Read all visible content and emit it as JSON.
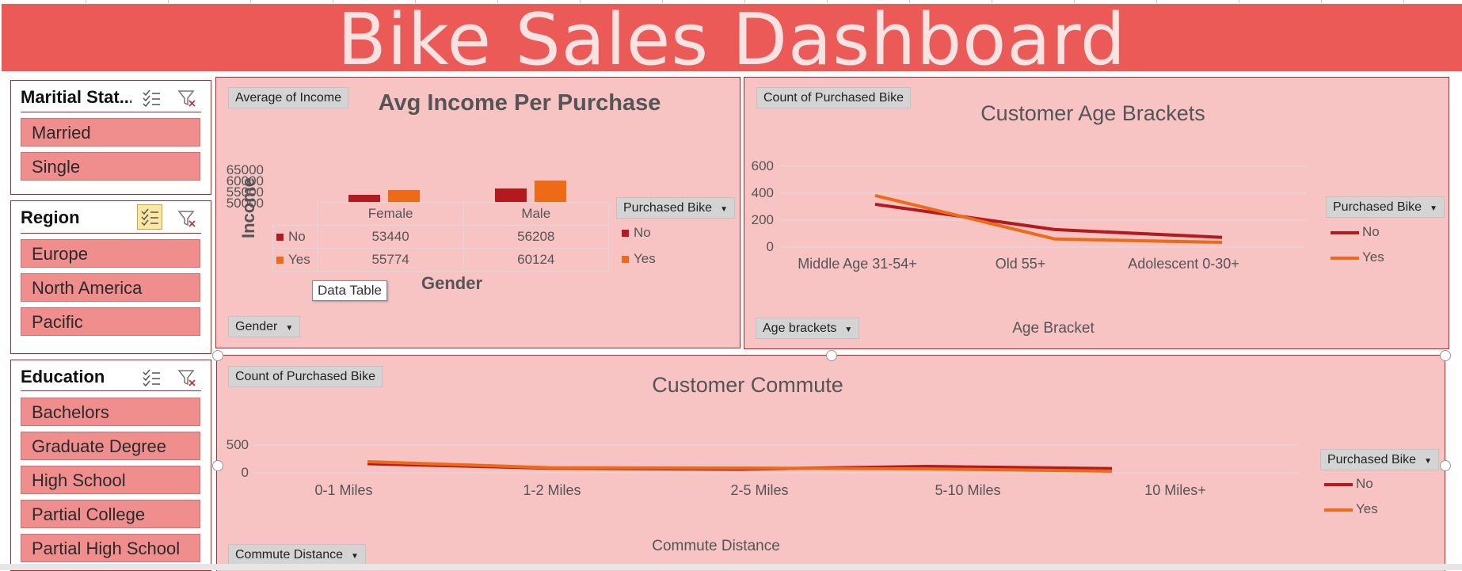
{
  "dashboard": {
    "title": "Bike Sales Dashboard"
  },
  "colors": {
    "banner": "#ec5a57",
    "panel_bg": "#f7c3c3",
    "slicer_btn": "#f08d8d",
    "series_no": "#b3191d",
    "series_yes": "#ee6a17"
  },
  "slicers": {
    "marital": {
      "title": "Maritial Stat...",
      "items": [
        "Married",
        "Single"
      ]
    },
    "region": {
      "title": "Region",
      "items": [
        "Europe",
        "North America",
        "Pacific"
      ]
    },
    "education": {
      "title": "Education",
      "items": [
        "Bachelors",
        "Graduate Degree",
        "High School",
        "Partial College",
        "Partial High School"
      ]
    }
  },
  "icons": {
    "multiselect": "multi-select-icon",
    "clear_filter": "clear-filter-icon"
  },
  "income_panel": {
    "value_button": "Average of Income",
    "title": "Avg Income Per Purchase",
    "ylabel": "Income",
    "xlabel": "Gender",
    "axis_button": "Gender",
    "legend_button": "Purchased Bike",
    "legend": [
      "No",
      "Yes"
    ],
    "table_rows": [
      {
        "name": "No",
        "values": [
          "53440",
          "56208"
        ]
      },
      {
        "name": "Yes",
        "values": [
          "55774",
          "60124"
        ]
      }
    ],
    "tooltip": "Data Table"
  },
  "age_panel": {
    "value_button": "Count of Purchased Bike",
    "title": "Customer Age Brackets",
    "xlabel": "Age Bracket",
    "axis_button": "Age brackets",
    "legend_button": "Purchased Bike",
    "legend": [
      "No",
      "Yes"
    ]
  },
  "commute_panel": {
    "value_button": "Count of Purchased Bike",
    "title": "Customer Commute",
    "xlabel": "Commute Distance",
    "axis_button": "Commute Distance",
    "legend_button": "Purchased Bike",
    "legend": [
      "No",
      "Yes"
    ]
  },
  "chart_data": [
    {
      "type": "bar",
      "title": "Avg Income Per Purchase",
      "xlabel": "Gender",
      "ylabel": "Income",
      "categories": [
        "Female",
        "Male"
      ],
      "series": [
        {
          "name": "No",
          "values": [
            53440,
            56208
          ]
        },
        {
          "name": "Yes",
          "values": [
            55774,
            60124
          ]
        }
      ],
      "ylim": [
        50000,
        65000
      ],
      "yticks": [
        "50000",
        "55000",
        "60000",
        "65000"
      ],
      "legend_position": "right"
    },
    {
      "type": "line",
      "title": "Customer Age Brackets",
      "xlabel": "Age Bracket",
      "categories": [
        "Middle Age 31-54+",
        "Old 55+",
        "Adolescent 0-30+"
      ],
      "series": [
        {
          "name": "No",
          "values": [
            318,
            130,
            72
          ]
        },
        {
          "name": "Yes",
          "values": [
            383,
            60,
            35
          ]
        }
      ],
      "ylim": [
        0,
        600
      ],
      "yticks": [
        "0",
        "200",
        "400",
        "600"
      ],
      "grid": true,
      "legend_position": "right"
    },
    {
      "type": "line",
      "title": "Customer Commute",
      "xlabel": "Commute Distance",
      "categories": [
        "0-1 Miles",
        "1-2 Miles",
        "2-5 Miles",
        "5-10 Miles",
        "10 Miles+"
      ],
      "series": [
        {
          "name": "No",
          "values": [
            165,
            80,
            65,
            115,
            75
          ]
        },
        {
          "name": "Yes",
          "values": [
            200,
            90,
            85,
            70,
            30
          ]
        }
      ],
      "ylim": [
        0,
        500
      ],
      "yticks": [
        "0",
        "500"
      ],
      "grid": true,
      "legend_position": "right"
    }
  ]
}
